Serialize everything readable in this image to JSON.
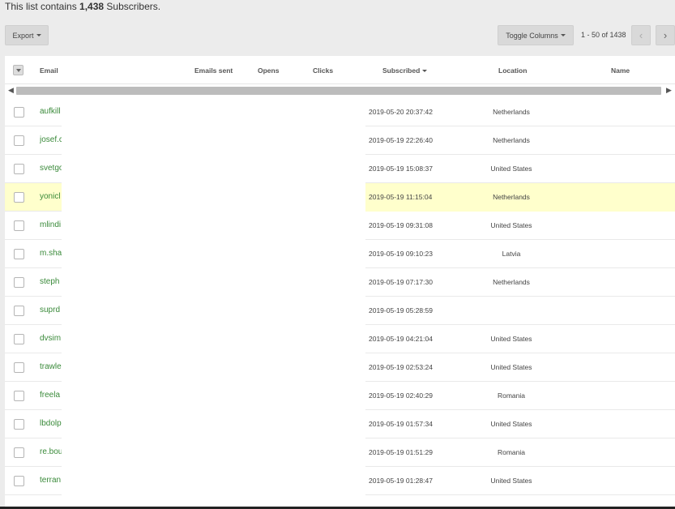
{
  "summary": {
    "prefix": "This list contains ",
    "count": "1,438",
    "suffix": " Subscribers."
  },
  "toolbar": {
    "export_label": "Export",
    "toggle_columns_label": "Toggle Columns",
    "page_info": "1 - 50 of 1438",
    "prev_icon": "chevron-left-icon",
    "next_icon": "chevron-right-icon"
  },
  "columns": {
    "email": "Email",
    "emails_sent": "Emails sent",
    "opens": "Opens",
    "clicks": "Clicks",
    "subscribed": "Subscribed",
    "location": "Location",
    "name": "Name"
  },
  "rows": [
    {
      "email": "aufkill",
      "subscribed": "2019-05-20 20:37:42",
      "location": "Netherlands",
      "highlight": false
    },
    {
      "email": "josef.c",
      "subscribed": "2019-05-19 22:26:40",
      "location": "Netherlands",
      "highlight": false
    },
    {
      "email": "svetgo",
      "subscribed": "2019-05-19 15:08:37",
      "location": "United States",
      "highlight": false
    },
    {
      "email": "yonicl",
      "subscribed": "2019-05-19 11:15:04",
      "location": "Netherlands",
      "highlight": true
    },
    {
      "email": "mlindi",
      "subscribed": "2019-05-19 09:31:08",
      "location": "United States",
      "highlight": false
    },
    {
      "email": "m.sha",
      "subscribed": "2019-05-19 09:10:23",
      "location": "Latvia",
      "highlight": false
    },
    {
      "email": "steph",
      "subscribed": "2019-05-19 07:17:30",
      "location": "Netherlands",
      "highlight": false
    },
    {
      "email": "suprd",
      "subscribed": "2019-05-19 05:28:59",
      "location": "",
      "highlight": false
    },
    {
      "email": "dvsim",
      "subscribed": "2019-05-19 04:21:04",
      "location": "United States",
      "highlight": false
    },
    {
      "email": "trawle",
      "subscribed": "2019-05-19 02:53:24",
      "location": "United States",
      "highlight": false
    },
    {
      "email": "freela",
      "subscribed": "2019-05-19 02:40:29",
      "location": "Romania",
      "highlight": false
    },
    {
      "email": "lbdolp",
      "subscribed": "2019-05-19 01:57:34",
      "location": "United States",
      "highlight": false
    },
    {
      "email": "re.bou",
      "subscribed": "2019-05-19 01:51:29",
      "location": "Romania",
      "highlight": false
    },
    {
      "email": "terran",
      "subscribed": "2019-05-19 01:28:47",
      "location": "United States",
      "highlight": false
    }
  ]
}
